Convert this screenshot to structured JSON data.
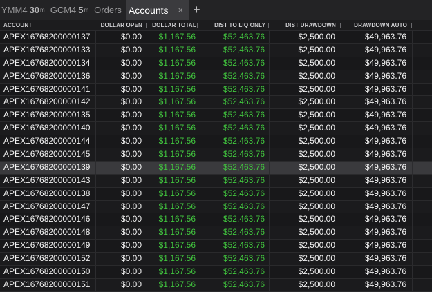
{
  "tabs": [
    {
      "symbol": "YMM4",
      "interval": "30",
      "unit": "m"
    },
    {
      "symbol": "GCM4",
      "interval": "5",
      "unit": "m"
    },
    {
      "label": "Orders"
    },
    {
      "label": "Accounts",
      "close": "×"
    }
  ],
  "add_tab": "+",
  "columns": [
    "ACCOUNT",
    "DOLLAR OPEN",
    "DOLLAR TOTAL",
    "DIST TO LIQ ONLY",
    "DIST DRAWDOWN",
    "DRAWDOWN AUTO"
  ],
  "colors": {
    "positive": "#41c43e",
    "selected_row": "#3a3a3d",
    "active_tab": "#3b3b3e"
  },
  "rows": [
    {
      "account": "APEX16768200000137",
      "open": "$0.00",
      "total": "$1,167.56",
      "liq": "$52,463.76",
      "dd": "$2,500.00",
      "auto": "$49,963.76"
    },
    {
      "account": "APEX16768200000133",
      "open": "$0.00",
      "total": "$1,167.56",
      "liq": "$52,463.76",
      "dd": "$2,500.00",
      "auto": "$49,963.76"
    },
    {
      "account": "APEX16768200000134",
      "open": "$0.00",
      "total": "$1,167.56",
      "liq": "$52,463.76",
      "dd": "$2,500.00",
      "auto": "$49,963.76"
    },
    {
      "account": "APEX16768200000136",
      "open": "$0.00",
      "total": "$1,167.56",
      "liq": "$52,463.76",
      "dd": "$2,500.00",
      "auto": "$49,963.76"
    },
    {
      "account": "APEX16768200000141",
      "open": "$0.00",
      "total": "$1,167.56",
      "liq": "$52,463.76",
      "dd": "$2,500.00",
      "auto": "$49,963.76"
    },
    {
      "account": "APEX16768200000142",
      "open": "$0.00",
      "total": "$1,167.56",
      "liq": "$52,463.76",
      "dd": "$2,500.00",
      "auto": "$49,963.76"
    },
    {
      "account": "APEX16768200000135",
      "open": "$0.00",
      "total": "$1,167.56",
      "liq": "$52,463.76",
      "dd": "$2,500.00",
      "auto": "$49,963.76"
    },
    {
      "account": "APEX16768200000140",
      "open": "$0.00",
      "total": "$1,167.56",
      "liq": "$52,463.76",
      "dd": "$2,500.00",
      "auto": "$49,963.76"
    },
    {
      "account": "APEX16768200000144",
      "open": "$0.00",
      "total": "$1,167.56",
      "liq": "$52,463.76",
      "dd": "$2,500.00",
      "auto": "$49,963.76"
    },
    {
      "account": "APEX16768200000145",
      "open": "$0.00",
      "total": "$1,167.56",
      "liq": "$52,463.76",
      "dd": "$2,500.00",
      "auto": "$49,963.76"
    },
    {
      "account": "APEX16768200000139",
      "open": "$0.00",
      "total": "$1,167.56",
      "liq": "$52,463.76",
      "dd": "$2,500.00",
      "auto": "$49,963.76",
      "selected": true
    },
    {
      "account": "APEX16768200000143",
      "open": "$0.00",
      "total": "$1,167.56",
      "liq": "$52,463.76",
      "dd": "$2,500.00",
      "auto": "$49,963.76"
    },
    {
      "account": "APEX16768200000138",
      "open": "$0.00",
      "total": "$1,167.56",
      "liq": "$52,463.76",
      "dd": "$2,500.00",
      "auto": "$49,963.76"
    },
    {
      "account": "APEX16768200000147",
      "open": "$0.00",
      "total": "$1,167.56",
      "liq": "$52,463.76",
      "dd": "$2,500.00",
      "auto": "$49,963.76"
    },
    {
      "account": "APEX16768200000146",
      "open": "$0.00",
      "total": "$1,167.56",
      "liq": "$52,463.76",
      "dd": "$2,500.00",
      "auto": "$49,963.76"
    },
    {
      "account": "APEX16768200000148",
      "open": "$0.00",
      "total": "$1,167.56",
      "liq": "$52,463.76",
      "dd": "$2,500.00",
      "auto": "$49,963.76"
    },
    {
      "account": "APEX16768200000149",
      "open": "$0.00",
      "total": "$1,167.56",
      "liq": "$52,463.76",
      "dd": "$2,500.00",
      "auto": "$49,963.76"
    },
    {
      "account": "APEX16768200000152",
      "open": "$0.00",
      "total": "$1,167.56",
      "liq": "$52,463.76",
      "dd": "$2,500.00",
      "auto": "$49,963.76"
    },
    {
      "account": "APEX16768200000150",
      "open": "$0.00",
      "total": "$1,167.56",
      "liq": "$52,463.76",
      "dd": "$2,500.00",
      "auto": "$49,963.76"
    },
    {
      "account": "APEX16768200000151",
      "open": "$0.00",
      "total": "$1,167.56",
      "liq": "$52,463.76",
      "dd": "$2,500.00",
      "auto": "$49,963.76"
    }
  ]
}
